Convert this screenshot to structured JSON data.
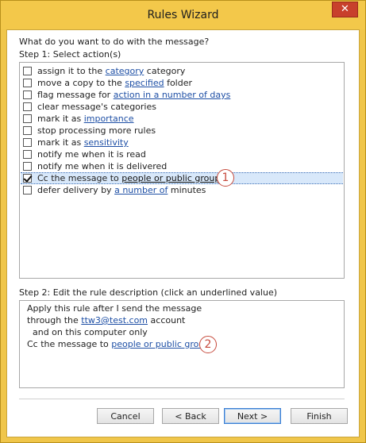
{
  "window": {
    "title": "Rules Wizard",
    "close_glyph": "✕"
  },
  "question": "What do you want to do with the message?",
  "step1_label": "Step 1: Select action(s)",
  "actions": [
    {
      "pre": "assign it to the ",
      "link": "category",
      "post": " category",
      "checked": false
    },
    {
      "pre": "move a copy to the ",
      "link": "specified",
      "post": " folder",
      "checked": false
    },
    {
      "pre": "flag message for ",
      "link": "action in a number of days",
      "post": "",
      "checked": false
    },
    {
      "pre": "clear message's categories",
      "link": "",
      "post": "",
      "checked": false
    },
    {
      "pre": "mark it as ",
      "link": "importance",
      "post": "",
      "checked": false
    },
    {
      "pre": "stop processing more rules",
      "link": "",
      "post": "",
      "checked": false
    },
    {
      "pre": "mark it as ",
      "link": "sensitivity",
      "post": "",
      "checked": false
    },
    {
      "pre": "notify me when it is read",
      "link": "",
      "post": "",
      "checked": false
    },
    {
      "pre": "notify me when it is delivered",
      "link": "",
      "post": "",
      "checked": false
    },
    {
      "pre": "Cc the message to ",
      "link": "people or public group",
      "post": "",
      "checked": true
    },
    {
      "pre": "defer delivery by ",
      "link": "a number of",
      "post": " minutes",
      "checked": false
    }
  ],
  "badges": {
    "one": "1",
    "two": "2"
  },
  "step2_label": "Step 2: Edit the rule description (click an underlined value)",
  "description": {
    "line1": "Apply this rule after I send the message",
    "line2_pre": "through the ",
    "line2_link": "ttw3@test.com",
    "line2_post": " account",
    "line3": "  and on this computer only",
    "line4_pre": "Cc the message to ",
    "line4_link": "people or public group"
  },
  "buttons": {
    "cancel": "Cancel",
    "back": "< Back",
    "next": "Next >",
    "finish": "Finish"
  }
}
